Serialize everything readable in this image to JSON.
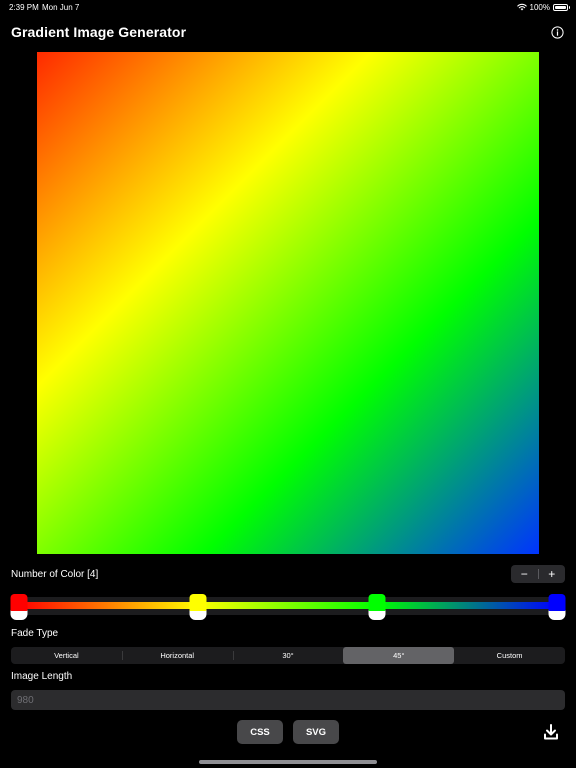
{
  "status_bar": {
    "time": "2:39 PM",
    "date": "Mon Jun 7",
    "battery": "100%",
    "battery_level": 1.0
  },
  "header": {
    "title": "Gradient Image Generator",
    "info_icon": "info-circle-icon"
  },
  "preview": {
    "angle_deg": 45,
    "colors": [
      "#ff2a00",
      "#ffff00",
      "#00ff00",
      "#0033ff"
    ]
  },
  "colors_section": {
    "label": "Number of Color [4]",
    "count": 4,
    "decrement_label": "−",
    "increment_label": "+",
    "stops": [
      {
        "color": "#ff0000",
        "position": 0.0
      },
      {
        "color": "#ffff00",
        "position": 0.333
      },
      {
        "color": "#00ff00",
        "position": 0.666
      },
      {
        "color": "#0000ff",
        "position": 1.0
      }
    ]
  },
  "fade": {
    "label": "Fade Type",
    "options": [
      "Vertical",
      "Horizontal",
      "30°",
      "45°",
      "Custom"
    ],
    "selected_index": 3
  },
  "image_length": {
    "label": "Image Length",
    "placeholder": "980",
    "value": ""
  },
  "actions": {
    "css_label": "CSS",
    "svg_label": "SVG",
    "download_icon": "download-icon"
  }
}
